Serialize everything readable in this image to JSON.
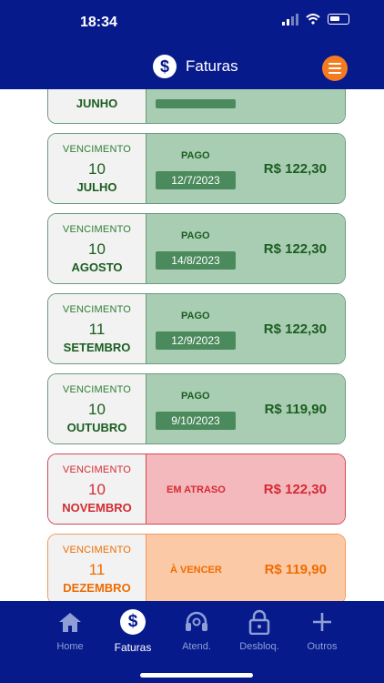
{
  "status_bar": {
    "time": "18:34"
  },
  "header": {
    "title": "Faturas",
    "icon": "dollar-icon",
    "menu_icon": "hamburger-menu-icon",
    "accent": "#f47b20"
  },
  "colors": {
    "brand": "#071a8c",
    "paid_bg": "#a9cdb3",
    "late_bg": "#f4b9bd",
    "due_bg": "#fcc9a6"
  },
  "partial_card": {
    "month": "JUNHO"
  },
  "invoices": [
    {
      "label": "VENCIMENTO",
      "day": "10",
      "month": "JULHO",
      "status": "PAGO",
      "paid_date": "12/7/2023",
      "amount": "R$ 122,30"
    },
    {
      "label": "VENCIMENTO",
      "day": "10",
      "month": "AGOSTO",
      "status": "PAGO",
      "paid_date": "14/8/2023",
      "amount": "R$ 122,30"
    },
    {
      "label": "VENCIMENTO",
      "day": "11",
      "month": "SETEMBRO",
      "status": "PAGO",
      "paid_date": "12/9/2023",
      "amount": "R$ 122,30"
    },
    {
      "label": "VENCIMENTO",
      "day": "10",
      "month": "OUTUBRO",
      "status": "PAGO",
      "paid_date": "9/10/2023",
      "amount": "R$ 119,90"
    },
    {
      "label": "VENCIMENTO",
      "day": "10",
      "month": "NOVEMBRO",
      "status": "EM ATRASO",
      "amount": "R$ 122,30"
    },
    {
      "label": "VENCIMENTO",
      "day": "11",
      "month": "DEZEMBRO",
      "status": "À VENCER",
      "amount": "R$ 119,90"
    }
  ],
  "tabs": [
    {
      "label": "Home",
      "icon": "home-icon"
    },
    {
      "label": "Faturas",
      "icon": "dollar-icon",
      "active": true
    },
    {
      "label": "Atend.",
      "icon": "headset-icon"
    },
    {
      "label": "Desbloq.",
      "icon": "unlock-icon"
    },
    {
      "label": "Outros",
      "icon": "plus-icon"
    }
  ]
}
